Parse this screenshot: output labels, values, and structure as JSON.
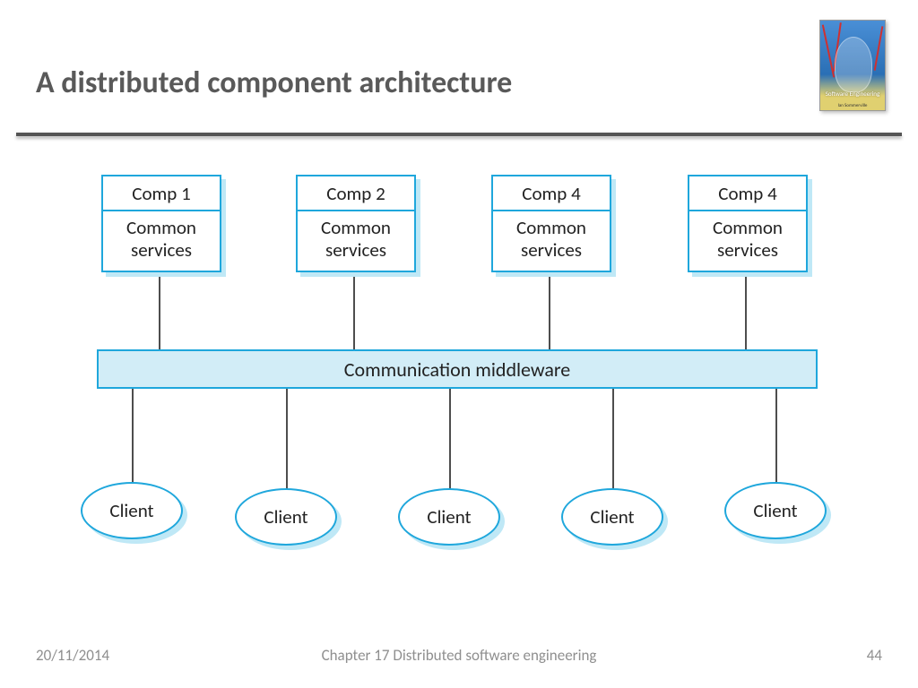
{
  "title": "A distributed component architecture",
  "book": {
    "title": "Software Engineering",
    "author": "Ian Sommerville"
  },
  "components": [
    {
      "name": "Comp 1",
      "sub": "Common services"
    },
    {
      "name": "Comp 2",
      "sub": "Common services"
    },
    {
      "name": "Comp 4",
      "sub": "Common services"
    },
    {
      "name": "Comp 4",
      "sub": "Common services"
    }
  ],
  "middleware": "Communication middleware",
  "clients": [
    "Client",
    "Client",
    "Client",
    "Client",
    "Client"
  ],
  "footer": {
    "date": "20/11/2014",
    "chapter": "Chapter 17 Distributed software engineering",
    "page": "44"
  }
}
